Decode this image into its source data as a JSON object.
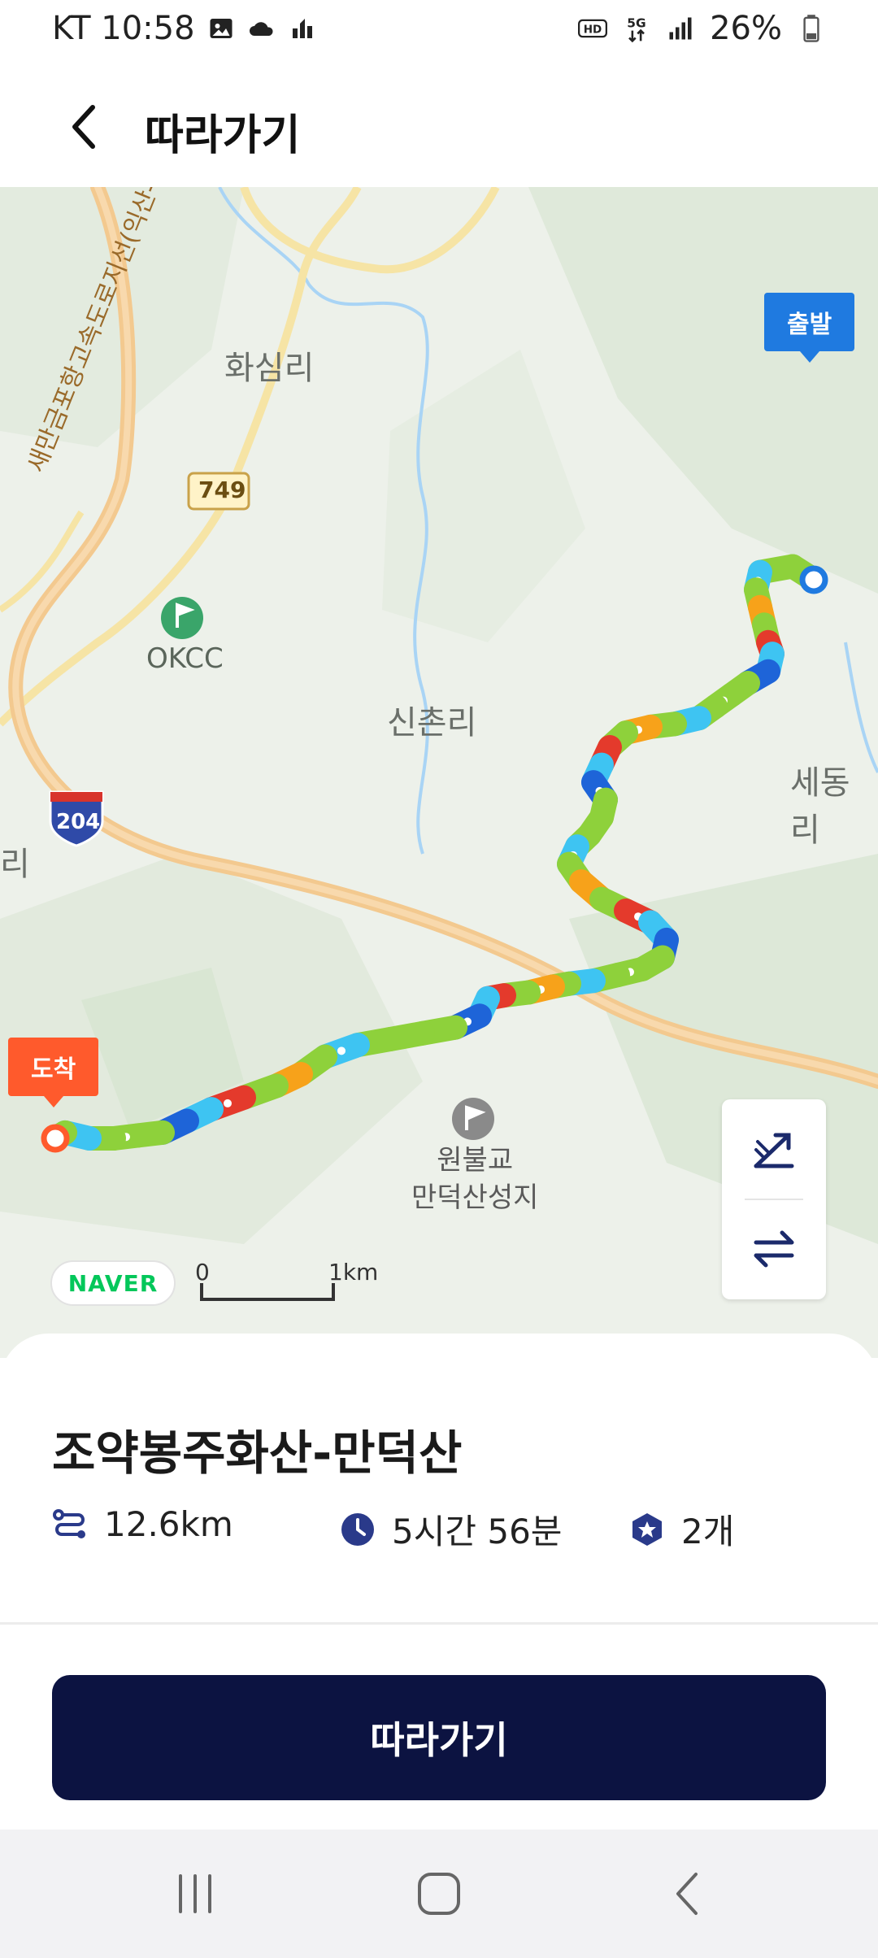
{
  "status_bar": {
    "carrier_time": "KT 10:58",
    "battery": "26%",
    "icons_left": [
      "image-icon",
      "cloud-icon",
      "signal-indicator-icon"
    ],
    "icons_right": [
      "hd-icon",
      "5g-icon",
      "signal-bars-icon",
      "battery-icon"
    ]
  },
  "header": {
    "title": "따라가기",
    "back_icon": "chevron-left-icon"
  },
  "map": {
    "labels": {
      "hwasimri": "화심리",
      "sinchonri": "신촌리",
      "sedongri": "세동리",
      "okcc": "OKCC",
      "temple": "원불교\n만덕산성지",
      "road_749": "749",
      "highway_204": "204",
      "expressway": "새만금포항고속도로지선(익산-장수)",
      "left_edge": "리"
    },
    "start_marker": "출발",
    "end_marker": "도착",
    "naver_badge": "NAVER",
    "scale": {
      "zero": "0",
      "distance": "1km"
    },
    "controls": [
      {
        "name": "elevation-toggle",
        "icon": "slope-icon"
      },
      {
        "name": "swap-direction",
        "icon": "swap-arrows-icon"
      }
    ]
  },
  "course": {
    "title": "조약봉주화산-만덕산",
    "distance": "12.6km",
    "duration": "5시간 56분",
    "badges": "2개"
  },
  "actions": {
    "follow_label": "따라가기"
  },
  "colors": {
    "primary_button": "#0c1341",
    "start_marker": "#1f7ae0",
    "end_marker": "#ff5a2c",
    "route_green": "#8ed13b",
    "route_cyan": "#3ec4f2",
    "route_orange": "#f7a21a",
    "route_red": "#e43a2c",
    "route_blue": "#1e64d8",
    "road_orange": "#f3c98f"
  },
  "nav_bar": {
    "icons": [
      "recent-apps-icon",
      "home-icon",
      "back-nav-icon"
    ]
  }
}
